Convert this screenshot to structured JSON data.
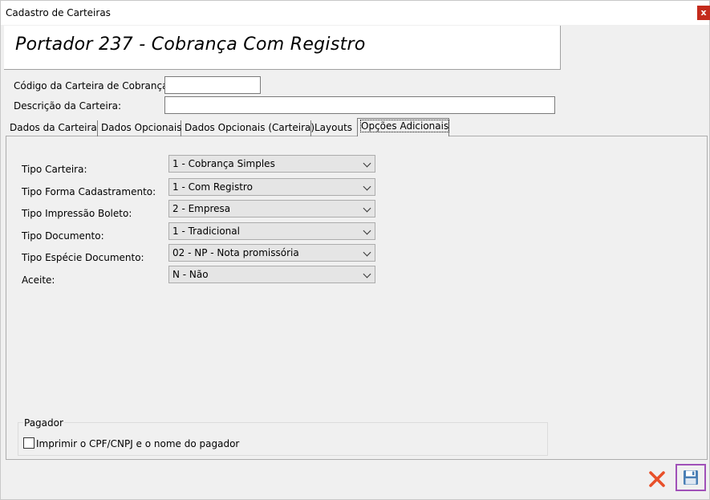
{
  "window": {
    "title": "Cadastro de Carteiras",
    "close_glyph": "x"
  },
  "header": {
    "title": "Portador 237 - Cobrança Com Registro"
  },
  "form": {
    "codigo_label": "Código da Carteira de Cobrança:",
    "codigo_value": "",
    "descricao_label": "Descrição da Carteira:",
    "descricao_value": ""
  },
  "tabs": [
    {
      "label": "Dados da Carteira",
      "active": false
    },
    {
      "label": "Dados Opcionais",
      "active": false
    },
    {
      "label": "Dados Opcionais (Carteira)",
      "active": false
    },
    {
      "label": "Layouts",
      "active": false
    },
    {
      "label": "Opções Adicionais",
      "active": true
    }
  ],
  "options": {
    "tipo_carteira": {
      "label": "Tipo Carteira:",
      "value": "1 - Cobrança Simples"
    },
    "tipo_forma": {
      "label": "Tipo Forma Cadastramento:",
      "value": "1 - Com Registro"
    },
    "tipo_impressao": {
      "label": "Tipo Impressão Boleto:",
      "value": "2 - Empresa"
    },
    "tipo_documento": {
      "label": "Tipo Documento:",
      "value": "1 - Tradicional"
    },
    "tipo_especie": {
      "label": "Tipo Espécie Documento:",
      "value": "02 - NP  - Nota promissória"
    },
    "aceite": {
      "label": "Aceite:",
      "value": "N - Não"
    }
  },
  "pagador": {
    "group_title": "Pagador",
    "checkbox_label": "Imprimir o CPF/CNPJ e o nome do pagador",
    "checked": false
  },
  "footer": {
    "cancel_icon": "red-x-icon",
    "save_icon": "floppy-disk-icon"
  },
  "colors": {
    "close_red": "#c42b1c",
    "cancel_orange": "#e8502a",
    "save_highlight": "#a050b8",
    "floppy_blue": "#4a7fb5"
  }
}
